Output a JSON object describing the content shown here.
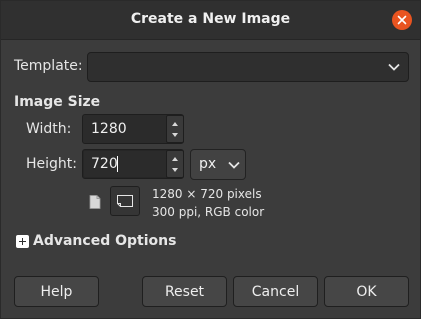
{
  "window": {
    "title": "Create a New Image"
  },
  "template": {
    "label": "Template:",
    "value": ""
  },
  "image_size": {
    "section_label": "Image Size",
    "width_label": "Width:",
    "width_value": "1280",
    "height_label": "Height:",
    "height_value": "720",
    "unit": "px",
    "info_pixels": "1280 × 720 pixels",
    "info_resolution": "300 ppi, RGB color"
  },
  "advanced": {
    "label": "Advanced Options"
  },
  "buttons": {
    "help": "Help",
    "reset": "Reset",
    "cancel": "Cancel",
    "ok": "OK"
  },
  "colors": {
    "accent_close": "#e95420",
    "background": "#3c3c3c"
  },
  "icons": {
    "portrait": "portrait-orientation-icon",
    "landscape": "landscape-orientation-icon"
  }
}
